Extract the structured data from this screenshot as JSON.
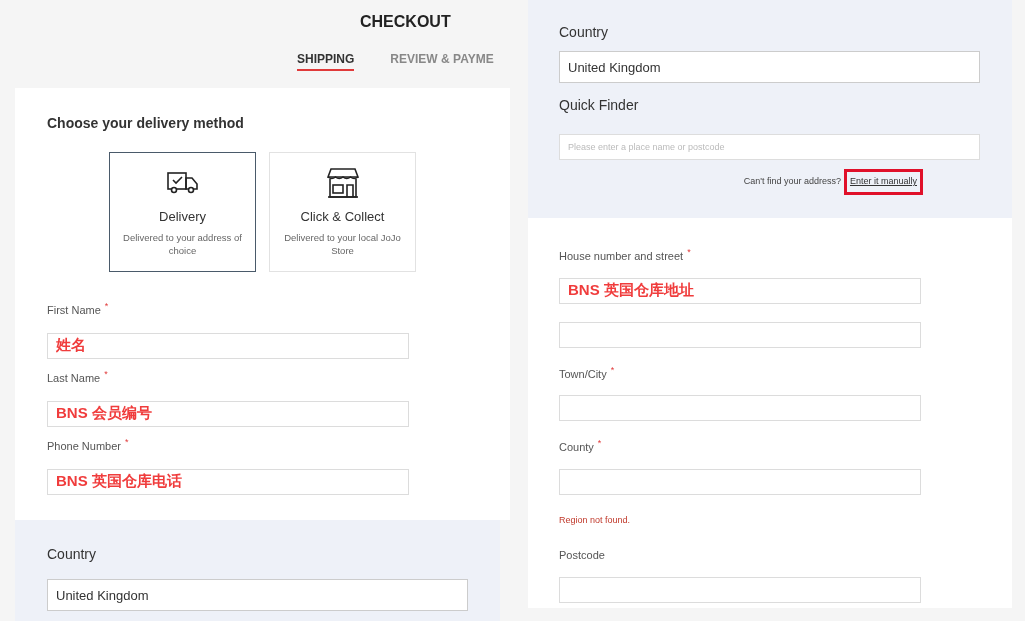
{
  "title": "CHECKOUT",
  "tabs": [
    {
      "label": "SHIPPING",
      "selected": true
    },
    {
      "label": "REVIEW & PAYME",
      "selected": false
    }
  ],
  "delivery": {
    "heading": "Choose your delivery method",
    "options": [
      {
        "kind": "truck",
        "title": "Delivery",
        "description": "Delivered to your address of choice",
        "selected": true
      },
      {
        "kind": "store",
        "title": "Click & Collect",
        "description": "Delivered to your local JoJo Store",
        "selected": false
      }
    ]
  },
  "contact_fields": [
    {
      "label": "First Name",
      "required_mark": "*",
      "value": "姓名"
    },
    {
      "label": "Last Name",
      "required_mark": "*",
      "value": "BNS 会员编号"
    },
    {
      "label": "Phone Number",
      "required_mark": "*",
      "value": "BNS 英国仓库电话"
    }
  ],
  "country_section": {
    "label": "Country",
    "value": "United Kingdom"
  },
  "address_panel": {
    "country_label": "Country",
    "country_value": "United Kingdom",
    "finder_label": "Quick Finder",
    "finder_placeholder": "Please enter a place name or postcode",
    "hint": "Can't find your address?",
    "link": "Enter it manually",
    "link_highlighted": true
  },
  "address_fields": [
    {
      "kind": "text",
      "label": "House number and street",
      "required_mark": "*",
      "value": "BNS 英国仓库地址"
    },
    {
      "kind": "text"
    },
    {
      "kind": "text",
      "label": "Town/City",
      "required_mark": "*"
    },
    {
      "kind": "text",
      "label": "County",
      "required_mark": "*",
      "error": "Region not found."
    },
    {
      "kind": "text",
      "label": "Postcode"
    }
  ]
}
